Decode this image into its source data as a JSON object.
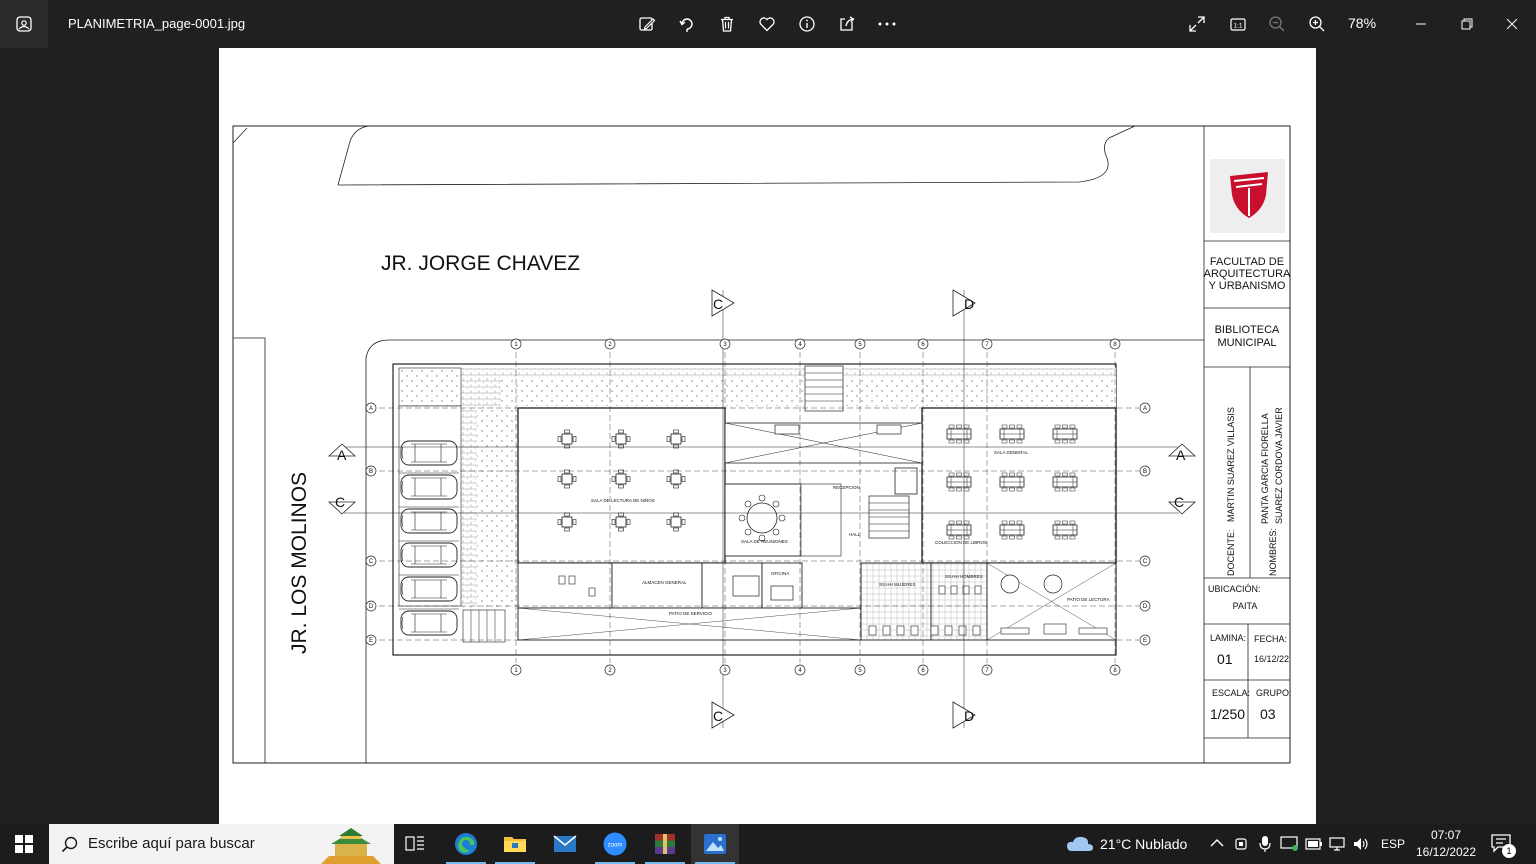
{
  "window": {
    "filename": "PLANIMETRIA_page-0001.jpg",
    "zoom": "78%"
  },
  "toolbar_icons": [
    "edit-image-icon",
    "rotate-icon",
    "delete-icon",
    "favorite-icon",
    "info-icon",
    "share-icon",
    "more-icon"
  ],
  "plan": {
    "street_top": "JR. JORGE CHAVEZ",
    "street_left": "JR.  LOS MOLINOS",
    "section_c": "C",
    "section_d": "D",
    "section_a": "A",
    "axes_numbers": [
      "1",
      "2",
      "3",
      "4",
      "5",
      "6",
      "7",
      "8"
    ],
    "axes_letters": [
      "A",
      "B",
      "C",
      "D",
      "E"
    ],
    "rooms": {
      "sala_ninos": "SALA DE LECTURA DE NIÑOS",
      "sala_general": "SALA GENERAL",
      "sala_reuniones": "SALA DE REUNIONES",
      "recepcion": "RECEPCION",
      "hall": "HALL",
      "coleccion": "COLECCION DE LIBROS",
      "almacen": "ALMACEN GENERAL",
      "patio_servicio": "PATIO DE SERVICIO",
      "oficina": "OFICINA",
      "ss_hh_mujeres": "SS.HH MUJERES",
      "ss_hh_hombres": "SS.HH HOMBRES",
      "patio_lectura": "PATIO DE LECTURA"
    }
  },
  "title_block": {
    "faculty": "FACULTAD DE ARQUITECTURA Y URBANISMO",
    "project": "BIBLIOTECA MUNICIPAL",
    "docente_label": "DOCENTE:",
    "docente": "MARTIN SUAREZ VILLASIS",
    "nombres_label": "NOMBRES:",
    "nombre1": "PANTA GARCIA FIORELLA",
    "nombre2": "SUAREZ CORDOVA JAVIER",
    "ubicacion_label": "UBICACIÓN:",
    "ubicacion": "PAITA",
    "lamina_label": "LAMINA:",
    "lamina": "01",
    "fecha_label": "FECHA:",
    "fecha": "16/12/22",
    "escala_label": "ESCALA:",
    "escala": "1/250",
    "grupo_label": "GRUPO:",
    "grupo": "03"
  },
  "taskbar": {
    "search_placeholder": "Escribe aquí para buscar",
    "weather": "21°C  Nublado",
    "language": "ESP",
    "time": "07:07",
    "date": "16/12/2022",
    "notification_count": "1"
  },
  "colors": {
    "accent": "#76b9ed",
    "logo_red": "#c8102e"
  }
}
